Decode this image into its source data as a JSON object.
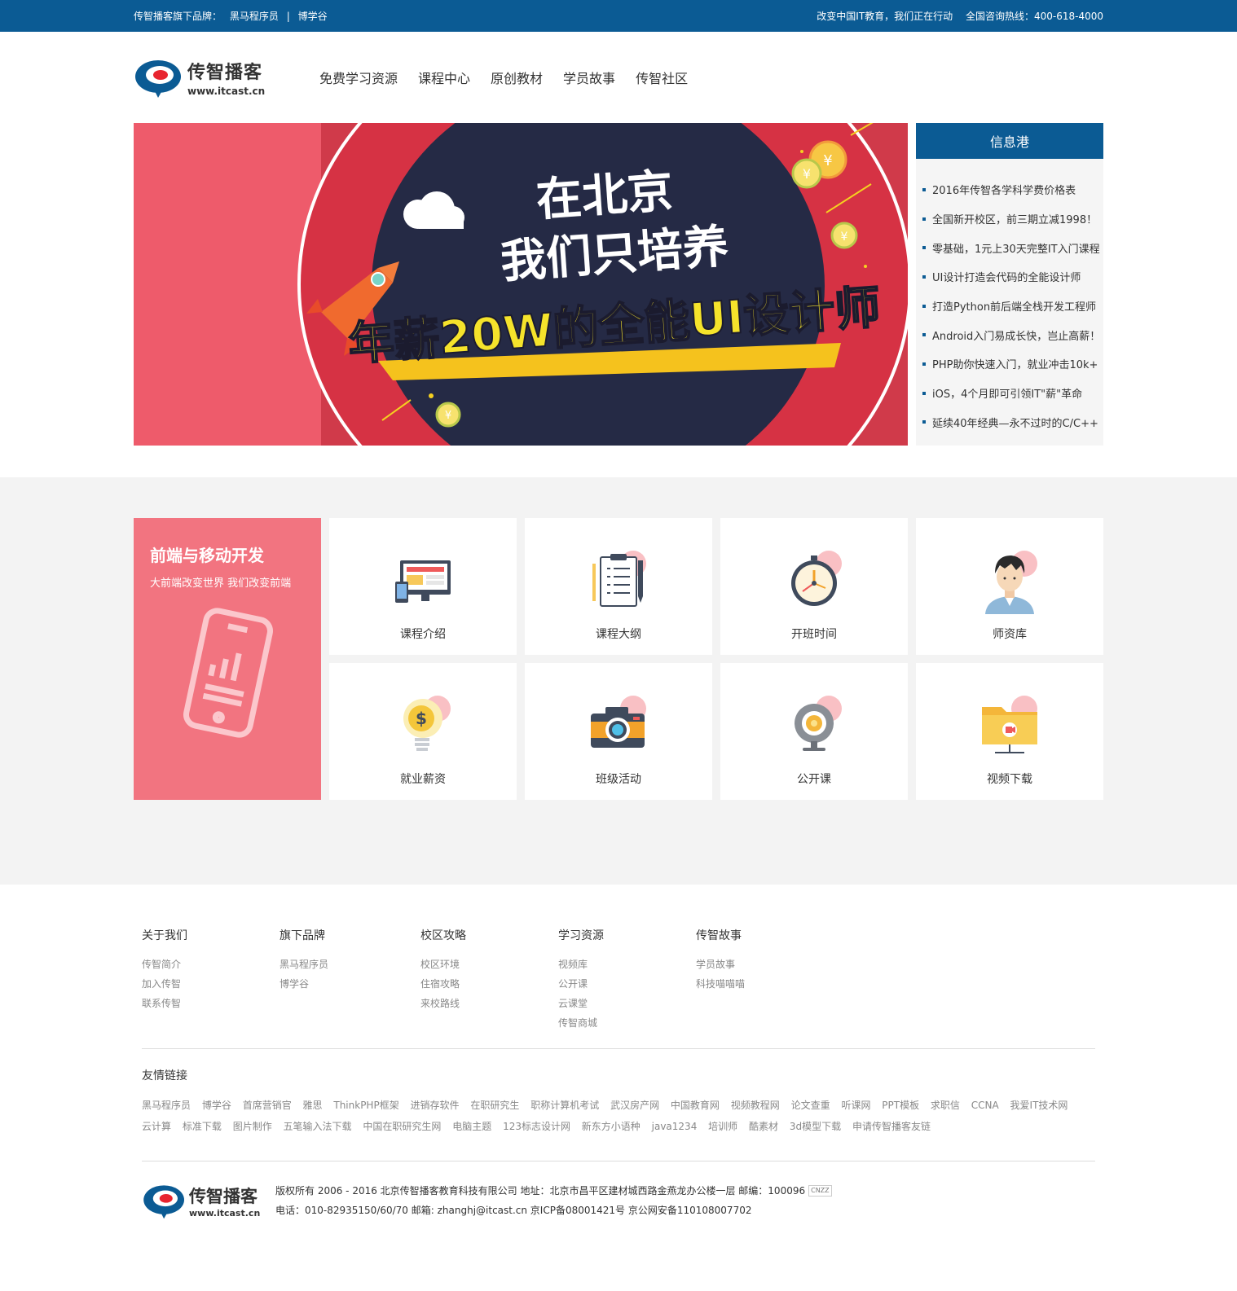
{
  "topbar": {
    "brand_prefix": "传智播客旗下品牌：",
    "brand1": "黑马程序员",
    "divider": "|",
    "brand2": "博学谷",
    "slogan": "改变中国IT教育，我们正在行动",
    "hotline": "全国咨询热线：400-618-4000"
  },
  "logo": {
    "cn": "传智播客",
    "url": "www.itcast.cn"
  },
  "nav": [
    "免费学习资源",
    "课程中心",
    "原创教材",
    "学员故事",
    "传智社区"
  ],
  "banner": {
    "line1": "在北京",
    "line2": "我们只培养",
    "line3": "年薪20W的全能UI设计师",
    "coin_symbol": "¥"
  },
  "info": {
    "title": "信息港",
    "items": [
      "2016年传智各学科学费价格表",
      "全国新开校区，前三期立减1998！",
      "零基础，1元上30天完整IT入门课程",
      "UI设计打造会代码的全能设计师",
      "打造Python前后端全栈开发工程师",
      "Android入门易成长快，岂止高薪！",
      "PHP助你快速入门，就业冲击10k+",
      "iOS，4个月即可引领IT\"薪\"革命",
      "延续40年经典—永不过时的C/C++"
    ]
  },
  "course": {
    "title": "前端与移动开发",
    "subtitle": "大前端改变世界 我们改变前端",
    "cards": [
      "课程介绍",
      "课程大纲",
      "开班时间",
      "师资库",
      "就业薪资",
      "班级活动",
      "公开课",
      "视频下载"
    ]
  },
  "footer": {
    "cols": [
      {
        "title": "关于我们",
        "items": [
          "传智简介",
          "加入传智",
          "联系传智"
        ]
      },
      {
        "title": "旗下品牌",
        "items": [
          "黑马程序员",
          "博学谷"
        ]
      },
      {
        "title": "校区攻略",
        "items": [
          "校区环境",
          "住宿攻略",
          "来校路线"
        ]
      },
      {
        "title": "学习资源",
        "items": [
          "视频库",
          "公开课",
          "云课堂",
          "传智商城"
        ]
      },
      {
        "title": "传智故事",
        "items": [
          "学员故事",
          "科技喵喵喵"
        ]
      }
    ],
    "links_title": "友情链接",
    "links": [
      "黑马程序员",
      "博学谷",
      "首席营销官",
      "雅思",
      "ThinkPHP框架",
      "进销存软件",
      "在职研究生",
      "职称计算机考试",
      "武汉房产网",
      "中国教育网",
      "视频教程网",
      "论文查重",
      "听课网",
      "PPT模板",
      "求职信",
      "CCNA",
      "我爱IT技术网",
      "云计算",
      "标准下载",
      "图片制作",
      "五笔输入法下载",
      "中国在职研究生网",
      "电脑主题",
      "123标志设计网",
      "新东方小语种",
      "java1234",
      "培训师",
      "酷素材",
      "3d模型下载",
      "申请传智播客友链"
    ],
    "copyright": "版权所有 2006 - 2016 北京传智播客教育科技有限公司   地址：北京市昌平区建材城西路金燕龙办公楼一层   邮编：100096",
    "contact": "电话：010-82935150/60/70   邮箱: zhanghj@itcast.cn   京ICP备08001421号   京公网安备110108007702",
    "cnzz": "CNZZ"
  },
  "colors": {
    "topbar": "#0b5b94",
    "feature": "#f27480",
    "banner": "#d03a4a",
    "banner_dark": "#252a45",
    "accent_yellow": "#f5d020"
  }
}
